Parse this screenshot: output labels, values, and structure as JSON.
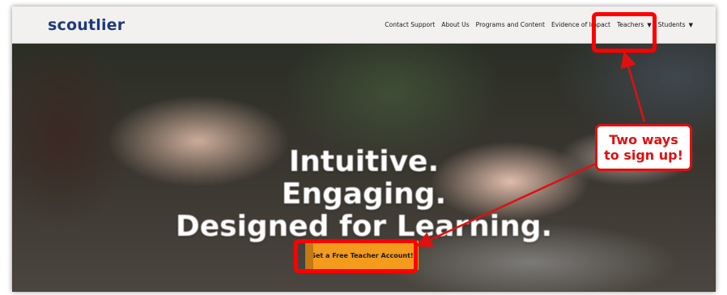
{
  "brand": {
    "logo": "scoutlier"
  },
  "nav": {
    "items": [
      {
        "label": "Contact Support",
        "has_caret": false
      },
      {
        "label": "About Us",
        "has_caret": false
      },
      {
        "label": "Programs and Content",
        "has_caret": false
      },
      {
        "label": "Evidence of Impact",
        "has_caret": false
      },
      {
        "label": "Teachers",
        "has_caret": true
      },
      {
        "label": "Students",
        "has_caret": true
      }
    ]
  },
  "hero": {
    "line1": "Intuitive.",
    "line2": "Engaging.",
    "line3": "Designed for Learning.",
    "cta_label": "Get a Free Teacher Account!"
  },
  "annotation": {
    "callout_line1": "Two ways",
    "callout_line2": "to sign up!",
    "color": "#e01010"
  },
  "colors": {
    "brand_blue": "#1f3a78",
    "accent_orange": "#f39b1c",
    "navbar_bg": "#f3f1f0"
  }
}
